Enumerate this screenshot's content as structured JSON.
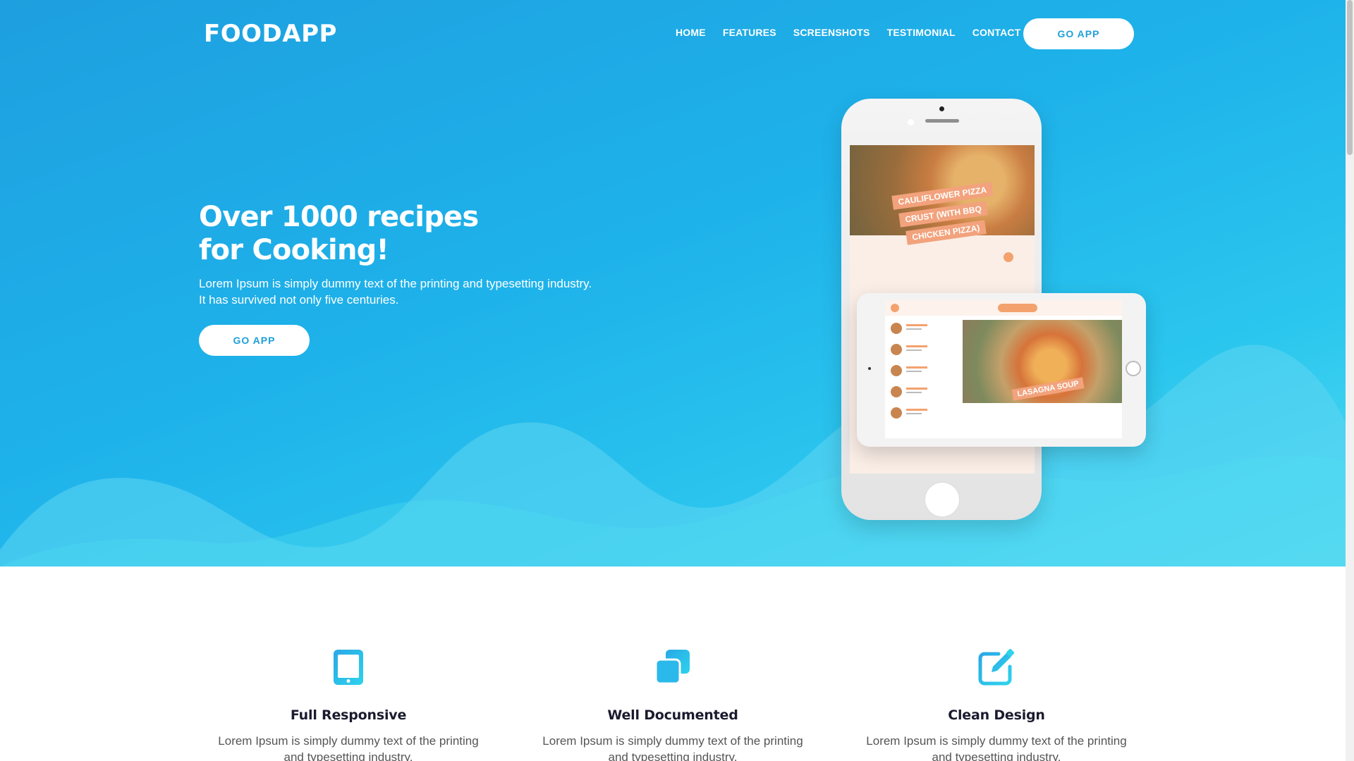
{
  "brand": {
    "logo": "FOODAPP"
  },
  "nav": {
    "items": [
      "HOME",
      "FEATURES",
      "SCREENSHOTS",
      "TESTIMONIAL",
      "CONTACT"
    ],
    "cta_label": "GO APP"
  },
  "hero": {
    "title_line1": "Over 1000 recipes",
    "title_line2": "for Cooking!",
    "description_line1": "Lorem Ipsum is simply dummy text of the printing and typesetting industry.",
    "description_line2": "It has survived not only five centuries.",
    "cta_label": "GO APP"
  },
  "mockup": {
    "phone_tags": [
      "CAULIFLOWER PIZZA",
      "CRUST (WITH BBQ",
      "CHICKEN PIZZA)"
    ],
    "tablet_tag": "LASAGNA SOUP"
  },
  "features": [
    {
      "icon": "tablet-icon",
      "title": "Full Responsive",
      "text_line1": "Lorem Ipsum is simply dummy text of the printing",
      "text_line2": "and typesetting industry."
    },
    {
      "icon": "copy-icon",
      "title": "Well Documented",
      "text_line1": "Lorem Ipsum is simply dummy text of the printing",
      "text_line2": "and typesetting industry."
    },
    {
      "icon": "edit-icon",
      "title": "Clean Design",
      "text_line1": "Lorem Ipsum is simply dummy text of the printing",
      "text_line2": "and typesetting industry."
    }
  ],
  "colors": {
    "hero_gradient_start": "#1e9fdf",
    "hero_gradient_end": "#4fdcf2",
    "accent_blue": "#1f9fd8",
    "food_orange": "#f3a26e"
  }
}
